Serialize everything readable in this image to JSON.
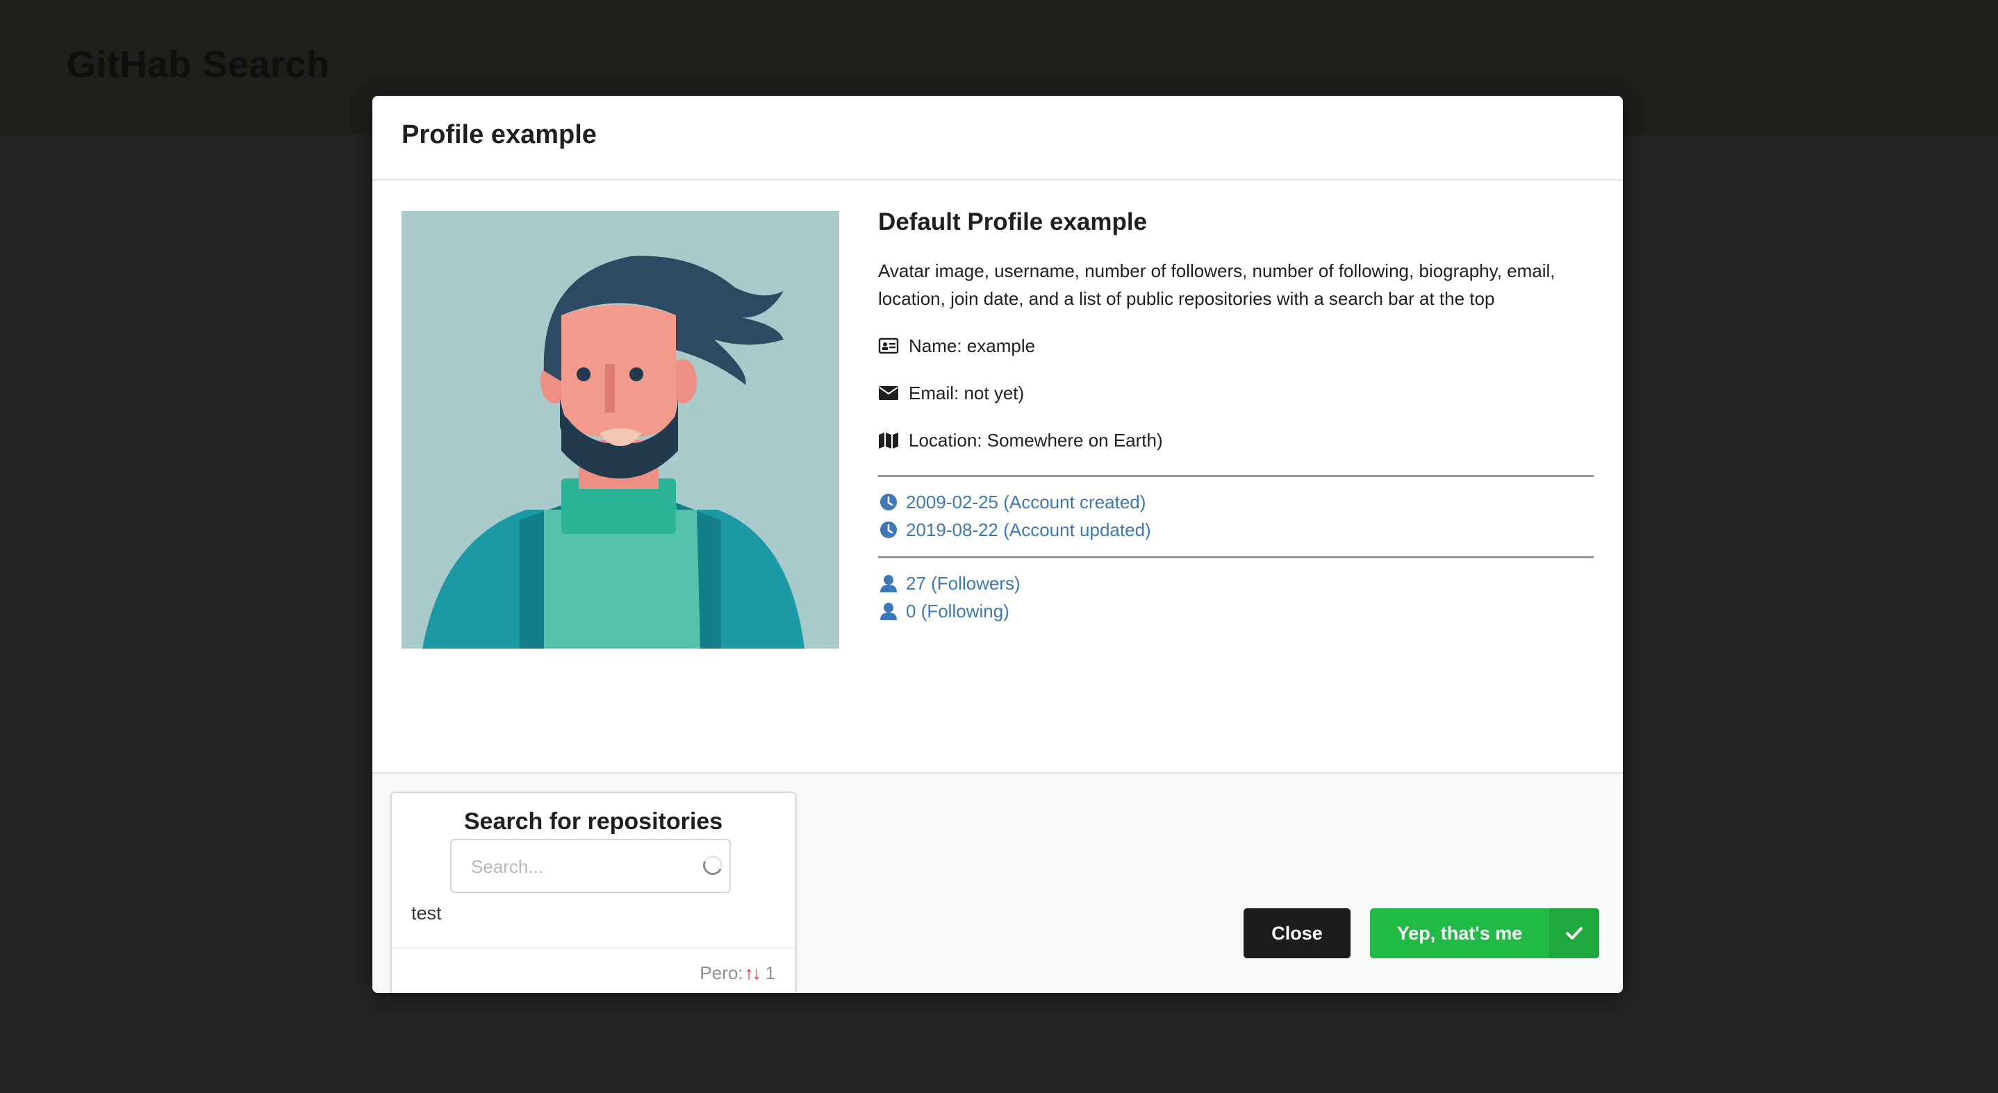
{
  "app": {
    "title": "GitHab Search"
  },
  "modal": {
    "title": "Profile example",
    "profile": {
      "heading": "Default Profile example",
      "description": "Avatar image, username, number of followers, number of following, biography, email, location, join date, and a list of public repositories with a search bar at the top",
      "name": "Name: example",
      "email": "Email: not yet)",
      "location": "Location: Somewhere on Earth)",
      "created": "2009-02-25 (Account created)",
      "updated": "2019-08-22 (Account updated)",
      "followers": "27 (Followers)",
      "following": "0 (Following)"
    },
    "repos": {
      "title": "Search for repositories",
      "search_placeholder": "Search...",
      "search_value": "",
      "item": "test",
      "meta_label": "Pero:",
      "meta_count": "1"
    },
    "buttons": {
      "close": "Close",
      "confirm": "Yep, that's me"
    }
  },
  "colors": {
    "link": "#3d78b8",
    "confirm_green": "#21ba45",
    "close_dark": "#1b1c1d",
    "sort_red": "#e0282d"
  },
  "icons": [
    "id-card-icon",
    "envelope-icon",
    "map-icon",
    "clock-icon",
    "user-icon",
    "sort-icon",
    "check-icon",
    "spinner-icon"
  ]
}
